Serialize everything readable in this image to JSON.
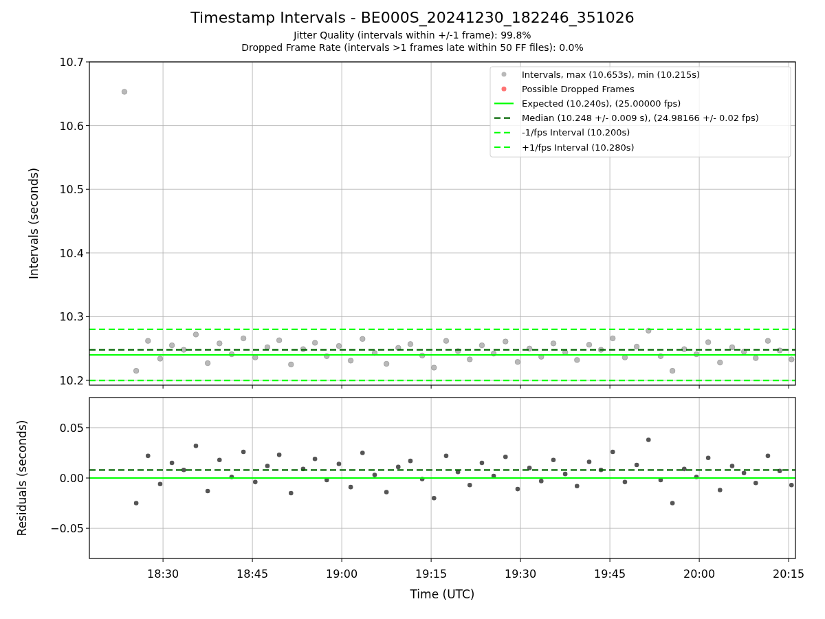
{
  "figure": {
    "title": "Timestamp Intervals - BE000S_20241230_182246_351026",
    "subtitles": [
      "Jitter Quality (intervals within +/-1 frame): 99.8%",
      "Dropped Frame Rate (intervals >1 frames late within 50 FF files): 0.0%"
    ]
  },
  "intervals_panel": {
    "chart_data": {
      "type": "scatter",
      "ylabel": "Intervals (seconds)",
      "xlim": [
        18.294,
        20.269
      ],
      "ylim": [
        10.1925,
        10.7
      ],
      "yticks": [
        {
          "value": 10.2,
          "label": "10.2"
        },
        {
          "value": 10.3,
          "label": "10.3"
        },
        {
          "value": 10.4,
          "label": "10.4"
        },
        {
          "value": 10.5,
          "label": "10.5"
        },
        {
          "value": 10.6,
          "label": "10.6"
        },
        {
          "value": 10.7,
          "label": "10.7"
        }
      ],
      "series": [
        {
          "name": "Intervals, max (10.653s), min (10.215s)",
          "color": "#808080",
          "x": [
            18.392,
            18.425,
            18.458,
            18.492,
            18.525,
            18.558,
            18.592,
            18.625,
            18.658,
            18.692,
            18.725,
            18.758,
            18.792,
            18.825,
            18.858,
            18.892,
            18.925,
            18.958,
            18.992,
            19.025,
            19.058,
            19.092,
            19.125,
            19.158,
            19.192,
            19.225,
            19.258,
            19.292,
            19.325,
            19.358,
            19.392,
            19.425,
            19.458,
            19.492,
            19.525,
            19.558,
            19.592,
            19.625,
            19.658,
            19.692,
            19.725,
            19.758,
            19.792,
            19.825,
            19.858,
            19.892,
            19.925,
            19.958,
            19.992,
            20.025,
            20.058,
            20.092,
            20.125,
            20.158,
            20.192,
            20.225,
            20.258
          ],
          "values": [
            10.653,
            10.215,
            10.262,
            10.234,
            10.255,
            10.248,
            10.272,
            10.227,
            10.258,
            10.241,
            10.266,
            10.236,
            10.252,
            10.263,
            10.225,
            10.249,
            10.259,
            10.238,
            10.254,
            10.231,
            10.265,
            10.243,
            10.226,
            10.251,
            10.257,
            10.239,
            10.22,
            10.262,
            10.246,
            10.233,
            10.255,
            10.242,
            10.261,
            10.229,
            10.25,
            10.237,
            10.258,
            10.244,
            10.232,
            10.256,
            10.248,
            10.266,
            10.236,
            10.253,
            10.278,
            10.238,
            10.215,
            10.249,
            10.241,
            10.26,
            10.228,
            10.252,
            10.245,
            10.235,
            10.262,
            10.247,
            10.233
          ]
        },
        {
          "name": "Possible Dropped Frames",
          "color": "#ff0000"
        }
      ],
      "ref_lines": [
        {
          "axis": "y",
          "value": 10.24,
          "label": "Expected (10.240s), (25.00000 fps)",
          "color": "#00ff00"
        },
        {
          "axis": "y",
          "value": 10.248,
          "label": "Median (10.248 +/- 0.009 s), (24.98166 +/- 0.02 fps)",
          "color": "#006400"
        },
        {
          "axis": "y",
          "value": 10.2,
          "label": "-1/fps Interval (10.200s)",
          "color": "#00ff00"
        },
        {
          "axis": "y",
          "value": 10.28,
          "label": "+1/fps Interval (10.280s)",
          "color": "#00ff00"
        }
      ],
      "grid": true,
      "legend": true
    }
  },
  "residuals_panel": {
    "chart_data": {
      "type": "scatter",
      "xlabel": "Time (UTC)",
      "ylabel": "Residuals (seconds)",
      "grid": true,
      "xlim": [
        18.294,
        20.269
      ],
      "ylim": [
        -0.08,
        0.08
      ],
      "xticks": [
        {
          "value": 18.5,
          "label": "18:30"
        },
        {
          "value": 18.75,
          "label": "18:45"
        },
        {
          "value": 19,
          "label": "19:00"
        },
        {
          "value": 19.25,
          "label": "19:15"
        },
        {
          "value": 19.5,
          "label": "19:30"
        },
        {
          "value": 19.75,
          "label": "19:45"
        },
        {
          "value": 20,
          "label": "20:00"
        },
        {
          "value": 20.25,
          "label": "20:15"
        }
      ],
      "yticks": [
        {
          "value": 0.05,
          "label": "0.05"
        },
        {
          "value": 0,
          "label": "0.00"
        },
        {
          "value": -0.05,
          "label": "−0.05"
        }
      ],
      "series": [
        {
          "color": "#555555",
          "x": [
            18.425,
            18.458,
            18.492,
            18.525,
            18.558,
            18.592,
            18.625,
            18.658,
            18.692,
            18.725,
            18.758,
            18.792,
            18.825,
            18.858,
            18.892,
            18.925,
            18.958,
            18.992,
            19.025,
            19.058,
            19.092,
            19.125,
            19.158,
            19.192,
            19.225,
            19.258,
            19.292,
            19.325,
            19.358,
            19.392,
            19.425,
            19.458,
            19.492,
            19.525,
            19.558,
            19.592,
            19.625,
            19.658,
            19.692,
            19.725,
            19.758,
            19.792,
            19.825,
            19.858,
            19.892,
            19.925,
            19.958,
            19.992,
            20.025,
            20.058,
            20.092,
            20.125,
            20.158,
            20.192,
            20.225,
            20.258
          ],
          "values": [
            -0.025,
            0.022,
            -0.006,
            0.015,
            0.008,
            0.032,
            -0.013,
            0.018,
            0.001,
            0.026,
            -0.004,
            0.012,
            0.023,
            -0.015,
            0.009,
            0.019,
            -0.002,
            0.014,
            -0.009,
            0.025,
            0.003,
            -0.014,
            0.011,
            0.017,
            -0.001,
            -0.02,
            0.022,
            0.006,
            -0.007,
            0.015,
            0.002,
            0.021,
            -0.011,
            0.01,
            -0.003,
            0.018,
            0.004,
            -0.008,
            0.016,
            0.008,
            0.026,
            -0.004,
            0.013,
            0.038,
            -0.002,
            -0.025,
            0.009,
            0.001,
            0.02,
            -0.012,
            0.012,
            0.005,
            -0.005,
            0.022,
            0.007,
            -0.007
          ]
        }
      ],
      "ref_lines": [
        {
          "axis": "y",
          "value": 0,
          "color": "#00ff00"
        },
        {
          "axis": "y",
          "value": 0.008,
          "color": "#006400"
        }
      ]
    }
  }
}
